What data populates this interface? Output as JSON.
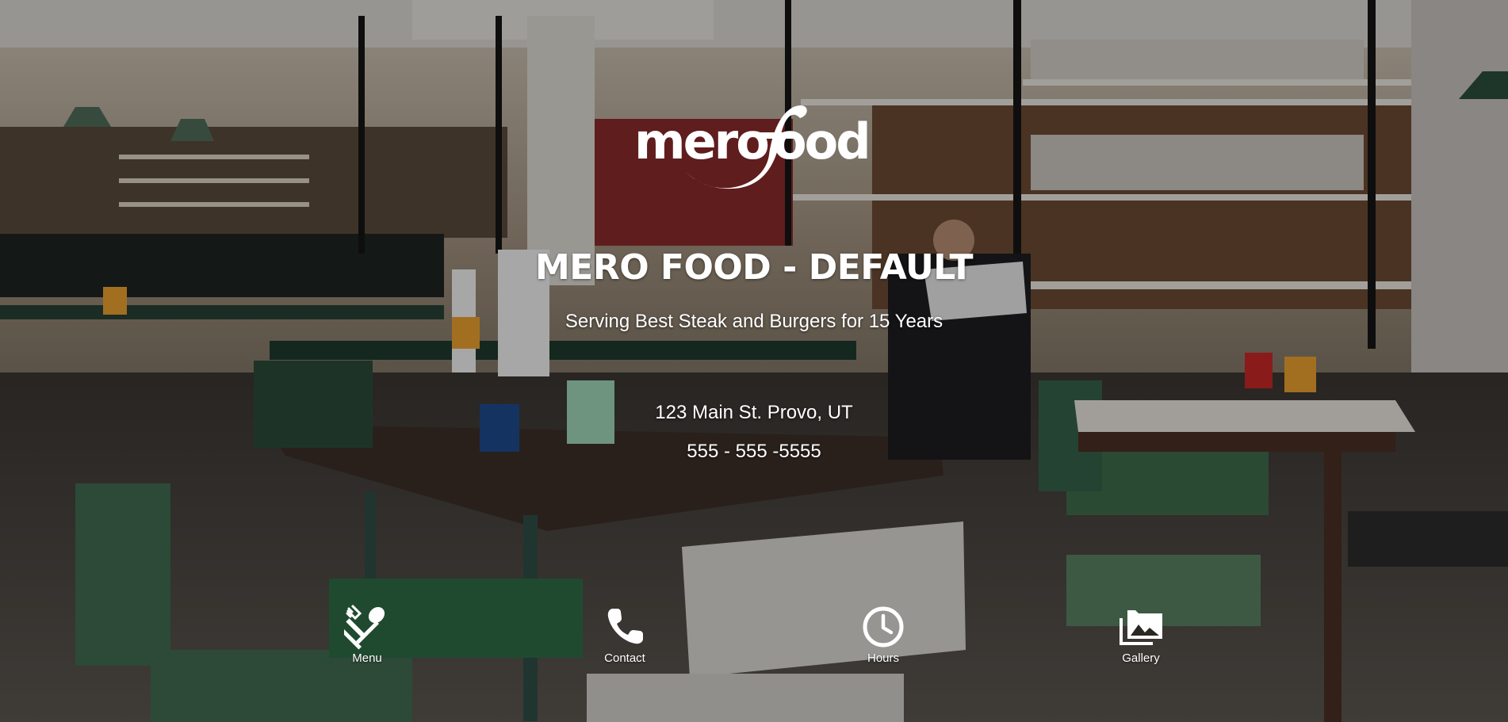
{
  "brand": {
    "logo_text": "meroFood"
  },
  "hero": {
    "title": "MERO FOOD - DEFAULT",
    "subtitle": "Serving Best Steak and Burgers for 15 Years",
    "address": "123 Main St. Provo, UT",
    "phone": "555 - 555 -5555"
  },
  "nav": [
    {
      "label": "Menu",
      "icon": "fork-spoon-icon"
    },
    {
      "label": "Contact",
      "icon": "phone-icon"
    },
    {
      "label": "Hours",
      "icon": "clock-icon"
    },
    {
      "label": "Gallery",
      "icon": "gallery-icon"
    }
  ],
  "colors": {
    "text": "#ffffff",
    "overlay": "rgba(0,0,0,0.30)"
  }
}
